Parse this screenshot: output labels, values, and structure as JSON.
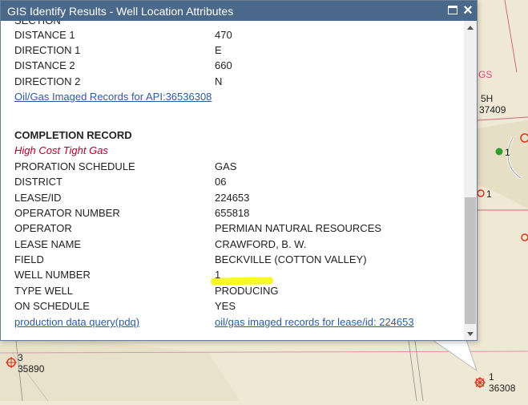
{
  "window": {
    "title": "GIS Identify Results - Well Location Attributes"
  },
  "top_partial_label": "SECTION",
  "location_rows": [
    {
      "label": "DISTANCE 1",
      "value": "470"
    },
    {
      "label": "DIRECTION 1",
      "value": "E"
    },
    {
      "label": "DISTANCE 2",
      "value": "660"
    },
    {
      "label": "DIRECTION 2",
      "value": "N"
    }
  ],
  "imaged_records_link": "Oil/Gas Imaged Records for API:36536308",
  "completion": {
    "heading": "COMPLETION RECORD",
    "subtitle": "High Cost Tight Gas",
    "rows": [
      {
        "label": "PRORATION SCHEDULE",
        "value": "GAS"
      },
      {
        "label": "DISTRICT",
        "value": "06"
      },
      {
        "label": "LEASE/ID",
        "value": "224653"
      },
      {
        "label": "OPERATOR NUMBER",
        "value": "655818"
      },
      {
        "label": "OPERATOR",
        "value": "PERMIAN NATURAL RESOURCES"
      },
      {
        "label": "LEASE NAME",
        "value": "CRAWFORD, B. W."
      },
      {
        "label": "FIELD",
        "value": "BECKVILLE (COTTON VALLEY)"
      },
      {
        "label": "WELL NUMBER",
        "value": "1"
      },
      {
        "label": "TYPE WELL",
        "value": "PRODUCING"
      },
      {
        "label": "ON SCHEDULE",
        "value": "YES"
      }
    ],
    "production_link": "production data query(pdq)",
    "lease_records_link": "oil/gas imaged records for lease/id: 224653"
  },
  "map_labels": {
    "gs": "GS",
    "well_5h": "5H",
    "well_37409": "37409",
    "green_well_num": "1",
    "right_well_num": "1",
    "left_well_num": "3",
    "left_well_api": "35890",
    "bottom_well_num": "1",
    "bottom_well_api": "36308"
  },
  "colors": {
    "titlebar": "#4a6889",
    "link": "#2a5c9c",
    "subtitle": "#b3002d",
    "highlight": "#f7f700"
  }
}
